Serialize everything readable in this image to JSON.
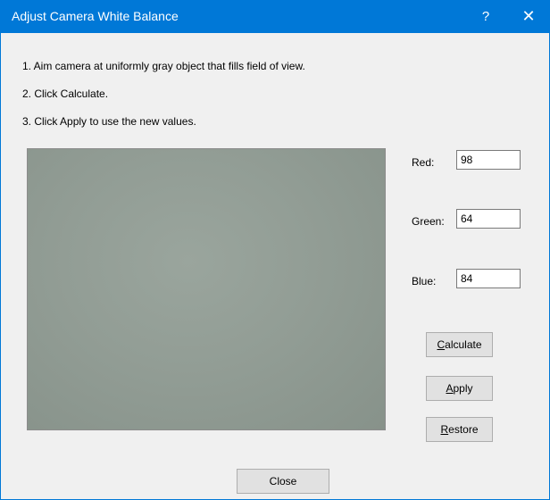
{
  "window": {
    "title": "Adjust Camera White Balance",
    "help_glyph": "?",
    "close_glyph": "✕",
    "colors": {
      "titlebar": "#0078d7",
      "dialog_bg": "#f0f0f0",
      "preview_gray": "#929d95",
      "button_bg": "#e1e1e1"
    }
  },
  "instructions": [
    "1. Aim camera at uniformly gray object that fills field of view.",
    "2. Click Calculate.",
    "3. Click Apply to use the new values."
  ],
  "fields": {
    "red": {
      "label": "Red:",
      "value": "98"
    },
    "green": {
      "label": "Green:",
      "value": "64"
    },
    "blue": {
      "label": "Blue:",
      "value": "84"
    }
  },
  "buttons": {
    "calculate": {
      "mnemonic": "C",
      "rest": "alculate"
    },
    "apply": {
      "mnemonic": "A",
      "rest": "pply"
    },
    "restore": {
      "mnemonic": "R",
      "rest": "estore"
    },
    "close": "Close"
  }
}
